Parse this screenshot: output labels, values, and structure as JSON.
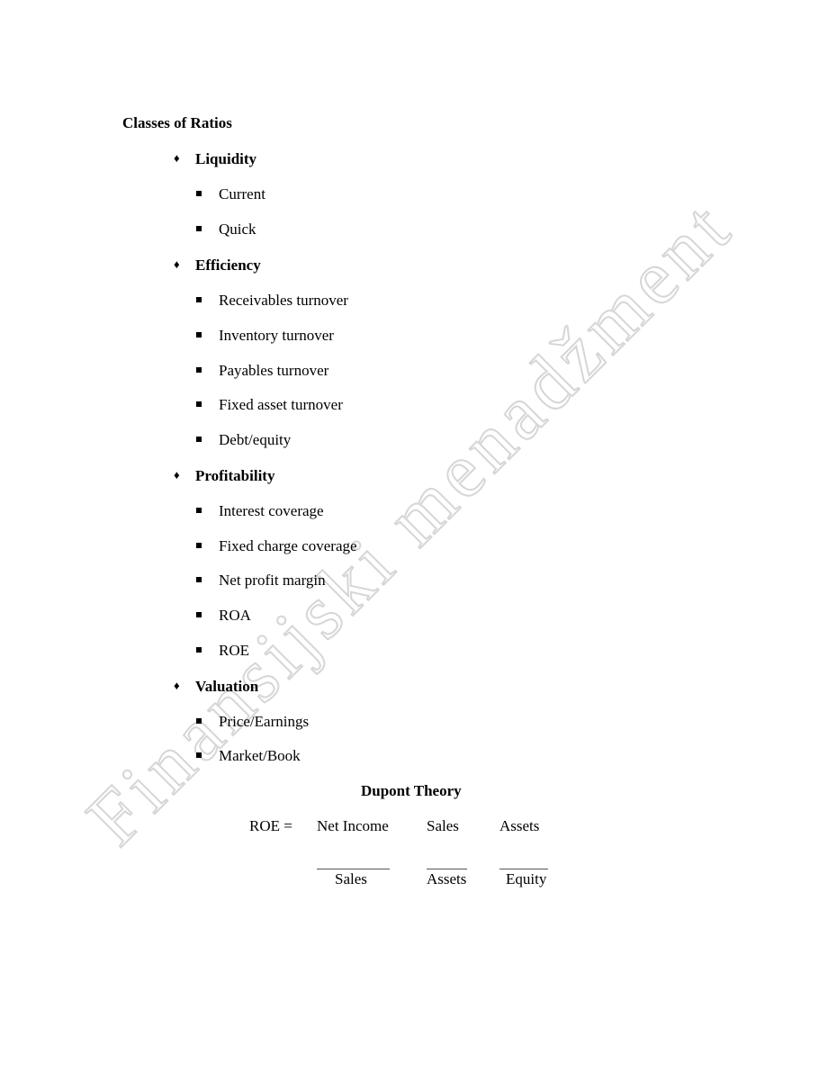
{
  "heading": "Classes of Ratios",
  "categories": [
    {
      "label": "Liquidity",
      "items": [
        "Current",
        "Quick"
      ]
    },
    {
      "label": "Efficiency",
      "items": [
        "Receivables turnover",
        "Inventory turnover",
        "Payables turnover",
        "Fixed asset turnover",
        "Debt/equity"
      ]
    },
    {
      "label": "Profitability",
      "items": [
        "Interest coverage",
        "Fixed charge coverage",
        "Net profit margin",
        "ROA",
        "ROE"
      ]
    },
    {
      "label": "Valuation",
      "items": [
        "Price/Earnings",
        "Market/Book"
      ]
    }
  ],
  "bullets": {
    "level1": "diamond-bullet",
    "level1_glyph": "♦",
    "level2": "square-bullet"
  },
  "dupont": {
    "title": "Dupont Theory",
    "lhs": "ROE =",
    "terms": [
      {
        "numerator": "Net Income",
        "denominator": "Sales"
      },
      {
        "numerator": "Sales",
        "denominator": "Assets"
      },
      {
        "numerator": "Assets",
        "denominator": "Equity"
      }
    ]
  },
  "watermark": "Finansijski menadžment"
}
